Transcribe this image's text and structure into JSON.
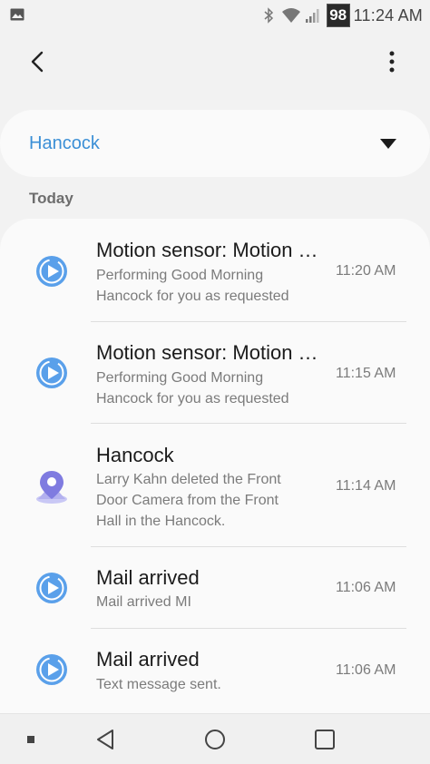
{
  "status_bar": {
    "battery_level": "98",
    "time": "11:24 AM",
    "icons": [
      "gallery-icon",
      "bluetooth-icon",
      "wifi-icon",
      "signal-icon"
    ]
  },
  "app_bar": {
    "back_icon": "chevron-left-icon",
    "more_icon": "more-vert-icon"
  },
  "location": {
    "name": "Hancock",
    "dropdown_icon": "caret-down-icon"
  },
  "section": {
    "label": "Today"
  },
  "notifications": [
    {
      "icon": "play-circle-icon",
      "title": "Motion sensor: Motion detected",
      "subtitle": [
        "Performing Good Morning",
        "Hancock for you as requested"
      ],
      "time": "11:20 AM"
    },
    {
      "icon": "play-circle-icon",
      "title": "Motion sensor: Motion detected",
      "subtitle": [
        "Performing Good Morning",
        "Hancock for you as requested"
      ],
      "time": "11:15 AM"
    },
    {
      "icon": "location-pin-icon",
      "title": "Hancock",
      "subtitle": [
        "Larry Kahn deleted the Front",
        "Door Camera from the Front",
        "Hall in the Hancock."
      ],
      "time": "11:14 AM"
    },
    {
      "icon": "play-circle-icon",
      "title": "Mail arrived",
      "subtitle": [
        "Mail arrived MI"
      ],
      "time": "11:06 AM"
    },
    {
      "icon": "play-circle-icon",
      "title": "Mail arrived",
      "subtitle": [
        "Text message sent."
      ],
      "time": "11:06 AM"
    }
  ],
  "nav_bar": {
    "buttons": [
      "recents-dot-icon",
      "back-triangle-icon",
      "home-circle-icon",
      "overview-square-icon"
    ]
  },
  "colors": {
    "accent": "#3b8fd6",
    "icon_blue": "#5aa0ea",
    "background": "#f2f2f2",
    "card": "#fafafa"
  }
}
